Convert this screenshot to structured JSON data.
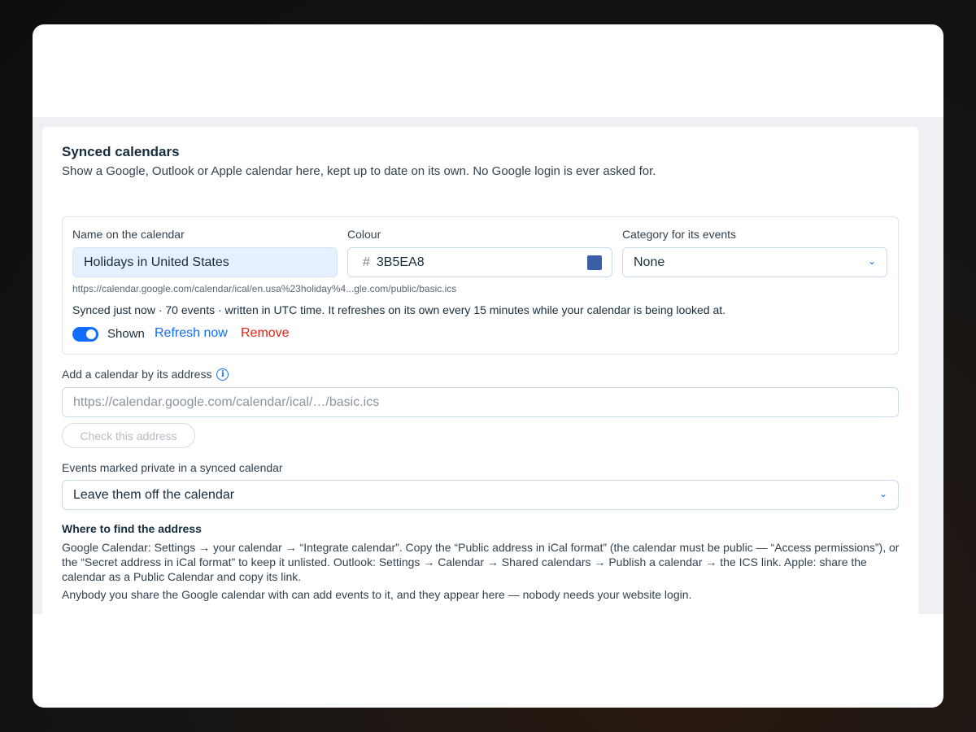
{
  "section": {
    "title": "Synced calendars",
    "subtitle": "Show a Google, Outlook or Apple calendar here, kept up to date on its own. No Google login is ever asked for."
  },
  "calendar": {
    "name_label": "Name on the calendar",
    "name_value": "Holidays in United States",
    "colour_label": "Colour",
    "colour_hash": "#",
    "colour_value": "3B5EA8",
    "colour_hex": "#3B5EA8",
    "category_label": "Category for its events",
    "category_value": "None",
    "url": "https://calendar.google.com/calendar/ical/en.usa%23holiday%4...gle.com/public/basic.ics",
    "sync_status": "Synced just now · 70 events · written in UTC time. It refreshes on its own every 15 minutes while your calendar is being looked at.",
    "shown_label": "Shown",
    "shown_on": true,
    "refresh_label": "Refresh now",
    "remove_label": "Remove"
  },
  "add": {
    "label": "Add a calendar by its address",
    "placeholder": "https://calendar.google.com/calendar/ical/…/basic.ics",
    "check_label": "Check this address"
  },
  "private_events": {
    "label": "Events marked private in a synced calendar",
    "value": "Leave them off the calendar"
  },
  "help": {
    "title": "Where to find the address",
    "body": "Google Calendar: Settings → your calendar → “Integrate calendar”. Copy the “Public address in iCal format” (the calendar must be public — “Access permissions”), or the “Secret address in iCal format” to keep it unlisted. Outlook: Settings → Calendar → Shared calendars → Publish a calendar → the ICS link. Apple: share the calendar as a Public Calendar and copy its link.",
    "note": "Anybody you share the Google calendar with can add events to it, and they appear here — nobody needs your website login."
  },
  "icons": {
    "info": "info-icon",
    "chevron": "chevron-down-icon"
  },
  "colors": {
    "accent": "#116dff",
    "danger": "#e62214"
  }
}
